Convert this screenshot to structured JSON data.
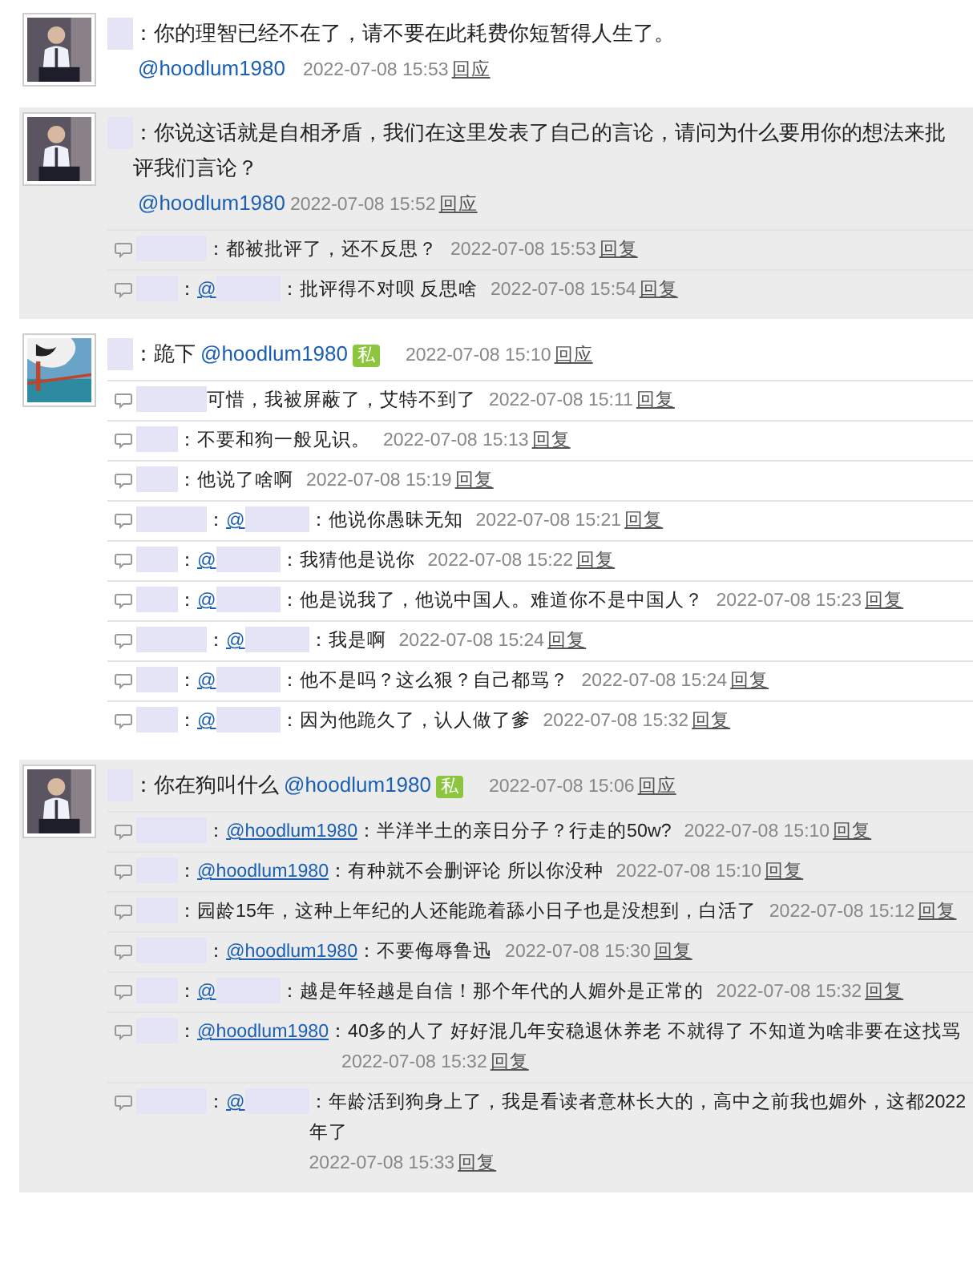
{
  "threads": [
    {
      "highlighted": false,
      "avatar": {
        "kind": "person"
      },
      "text": "：你的理智已经不在了，请不要在此耗费你短暂得人生了。",
      "mention": "@hoodlum1980",
      "time": "2022-07-08 15:53",
      "action": "回应"
    },
    {
      "highlighted": true,
      "avatar": {
        "kind": "person"
      },
      "text": "：你说这话就是自相矛盾，我们在这里发表了自己的言论，请问为什么要用你的想法来批评我们言论？",
      "mention": "@hoodlum1980",
      "time": "2022-07-08 15:52",
      "action": "回应",
      "replies": [
        {
          "text": "：都被批评了，还不反思？",
          "time": "2022-07-08 15:53",
          "action": "回复"
        },
        {
          "colon": "：",
          "mention": "@",
          "mention_hidden": true,
          "text": "：批评得不对呗 反思啥",
          "time": "2022-07-08 15:54",
          "action": "回复"
        }
      ]
    },
    {
      "highlighted": false,
      "avatar": {
        "kind": "bridge"
      },
      "text": "：跪下",
      "mention": "@hoodlum1980",
      "private": "私",
      "time": "2022-07-08 15:10",
      "action": "回应",
      "replies": [
        {
          "text": "可惜，我被屏蔽了，艾特不到了",
          "time": "2022-07-08 15:11",
          "action": "回复"
        },
        {
          "text": "：不要和狗一般见识。",
          "time": "2022-07-08 15:13",
          "action": "回复"
        },
        {
          "text": "：他说了啥啊",
          "time": "2022-07-08 15:19",
          "action": "回复"
        },
        {
          "colon": "：",
          "mention": "@",
          "mention_hidden": true,
          "text": "：他说你愚昧无知",
          "time": "2022-07-08 15:21",
          "action": "回复"
        },
        {
          "colon": "：",
          "mention": "@",
          "mention_hidden": true,
          "text": "：我猜他是说你",
          "time": "2022-07-08 15:22",
          "action": "回复"
        },
        {
          "colon": "：",
          "mention": "@",
          "mention_hidden": true,
          "text": "：他是说我了，他说中国人。难道你不是中国人？",
          "time": "2022-07-08 15:23",
          "action": "回复"
        },
        {
          "colon": "：",
          "mention": "@",
          "mention_hidden": true,
          "text": "：我是啊",
          "time": "2022-07-08 15:24",
          "action": "回复"
        },
        {
          "colon": "：",
          "mention": "@",
          "mention_hidden": true,
          "text": "：他不是吗？这么狠？自己都骂？",
          "time": "2022-07-08 15:24",
          "action": "回复"
        },
        {
          "colon": "：",
          "mention": "@",
          "mention_hidden": true,
          "text": "：因为他跪久了，认人做了爹",
          "time": "2022-07-08 15:32",
          "action": "回复"
        }
      ]
    },
    {
      "highlighted": true,
      "avatar": {
        "kind": "person"
      },
      "text": "：你在狗叫什么",
      "mention": "@hoodlum1980",
      "private": "私",
      "time": "2022-07-08 15:06",
      "action": "回应",
      "replies": [
        {
          "colon": "：",
          "mention": "@hoodlum1980",
          "mention_hidden": false,
          "text": "：半洋半土的亲日分子？行走的50w?",
          "time": "2022-07-08 15:10",
          "action": "回复"
        },
        {
          "colon": "：",
          "mention": "@hoodlum1980",
          "mention_hidden": false,
          "text": "：有种就不会删评论 所以你没种",
          "time": "2022-07-08 15:10",
          "action": "回复"
        },
        {
          "text": "：园龄15年，这种上年纪的人还能跪着舔小日子也是没想到，白活了",
          "time": "2022-07-08 15:12",
          "action": "回复"
        },
        {
          "colon": "：",
          "mention": "@hoodlum1980",
          "mention_hidden": false,
          "text": "：不要侮辱鲁迅",
          "time": "2022-07-08 15:30",
          "action": "回复"
        },
        {
          "colon": "：",
          "mention": "@",
          "mention_hidden": true,
          "text": "：越是年轻越是自信！那个年代的人媚外是正常的",
          "time": "2022-07-08 15:32",
          "action": "回复"
        },
        {
          "colon": "：",
          "mention": "@hoodlum1980",
          "mention_hidden": false,
          "text": "：40多的人了 好好混几年安稳退休养老 不就得了 不知道为啥非要在这找骂",
          "time": "2022-07-08 15:32",
          "action": "回复"
        },
        {
          "colon": "：",
          "mention": "@",
          "mention_hidden": true,
          "text": "：年龄活到狗身上了，我是看读者意林长大的，高中之前我也媚外，这都2022年了",
          "time": "2022-07-08 15:33",
          "action": "回复"
        }
      ]
    }
  ]
}
